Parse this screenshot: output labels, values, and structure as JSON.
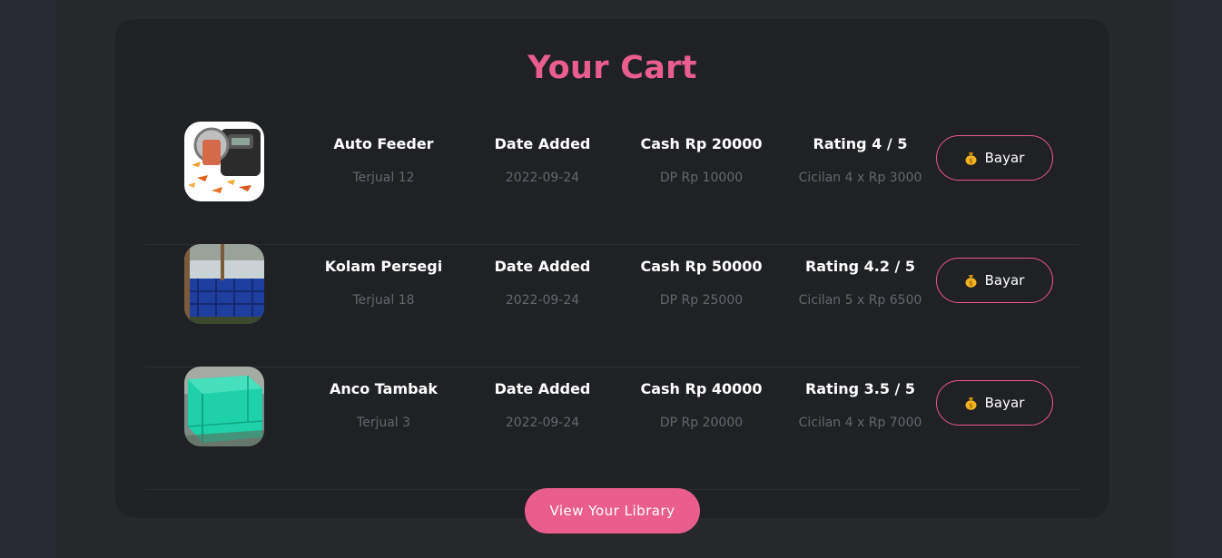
{
  "cart": {
    "title": "Your Cart",
    "items": [
      {
        "name": "Auto Feeder",
        "sold": "Terjual 12",
        "date_label": "Date Added",
        "date": "2022-09-24",
        "cash": "Cash Rp 20000",
        "dp": "DP Rp 10000",
        "rating": "Rating 4 / 5",
        "installment": "Cicilan 4 x Rp 3000",
        "pay_label": "Bayar",
        "pay_icon": "money-bag-icon",
        "thumb_icon": "auto-feeder-image"
      },
      {
        "name": "Kolam Persegi",
        "sold": "Terjual 18",
        "date_label": "Date Added",
        "date": "2022-09-24",
        "cash": "Cash Rp 50000",
        "dp": "DP Rp 25000",
        "rating": "Rating 4.2 / 5",
        "installment": "Cicilan 5 x Rp 6500",
        "pay_label": "Bayar",
        "pay_icon": "money-bag-icon",
        "thumb_icon": "square-pond-image"
      },
      {
        "name": "Anco Tambak",
        "sold": "Terjual 3",
        "date_label": "Date Added",
        "date": "2022-09-24",
        "cash": "Cash Rp 40000",
        "dp": "DP Rp 20000",
        "rating": "Rating 3.5 / 5",
        "installment": "Cicilan 4 x Rp 7000",
        "pay_label": "Bayar",
        "pay_icon": "money-bag-icon",
        "thumb_icon": "anco-net-image"
      }
    ],
    "view_library_label": "View Your Library"
  },
  "colors": {
    "accent": "#ea5e8e",
    "card_bg": "#202124",
    "page_bg": "#272a31",
    "muted_text": "#65676d"
  }
}
